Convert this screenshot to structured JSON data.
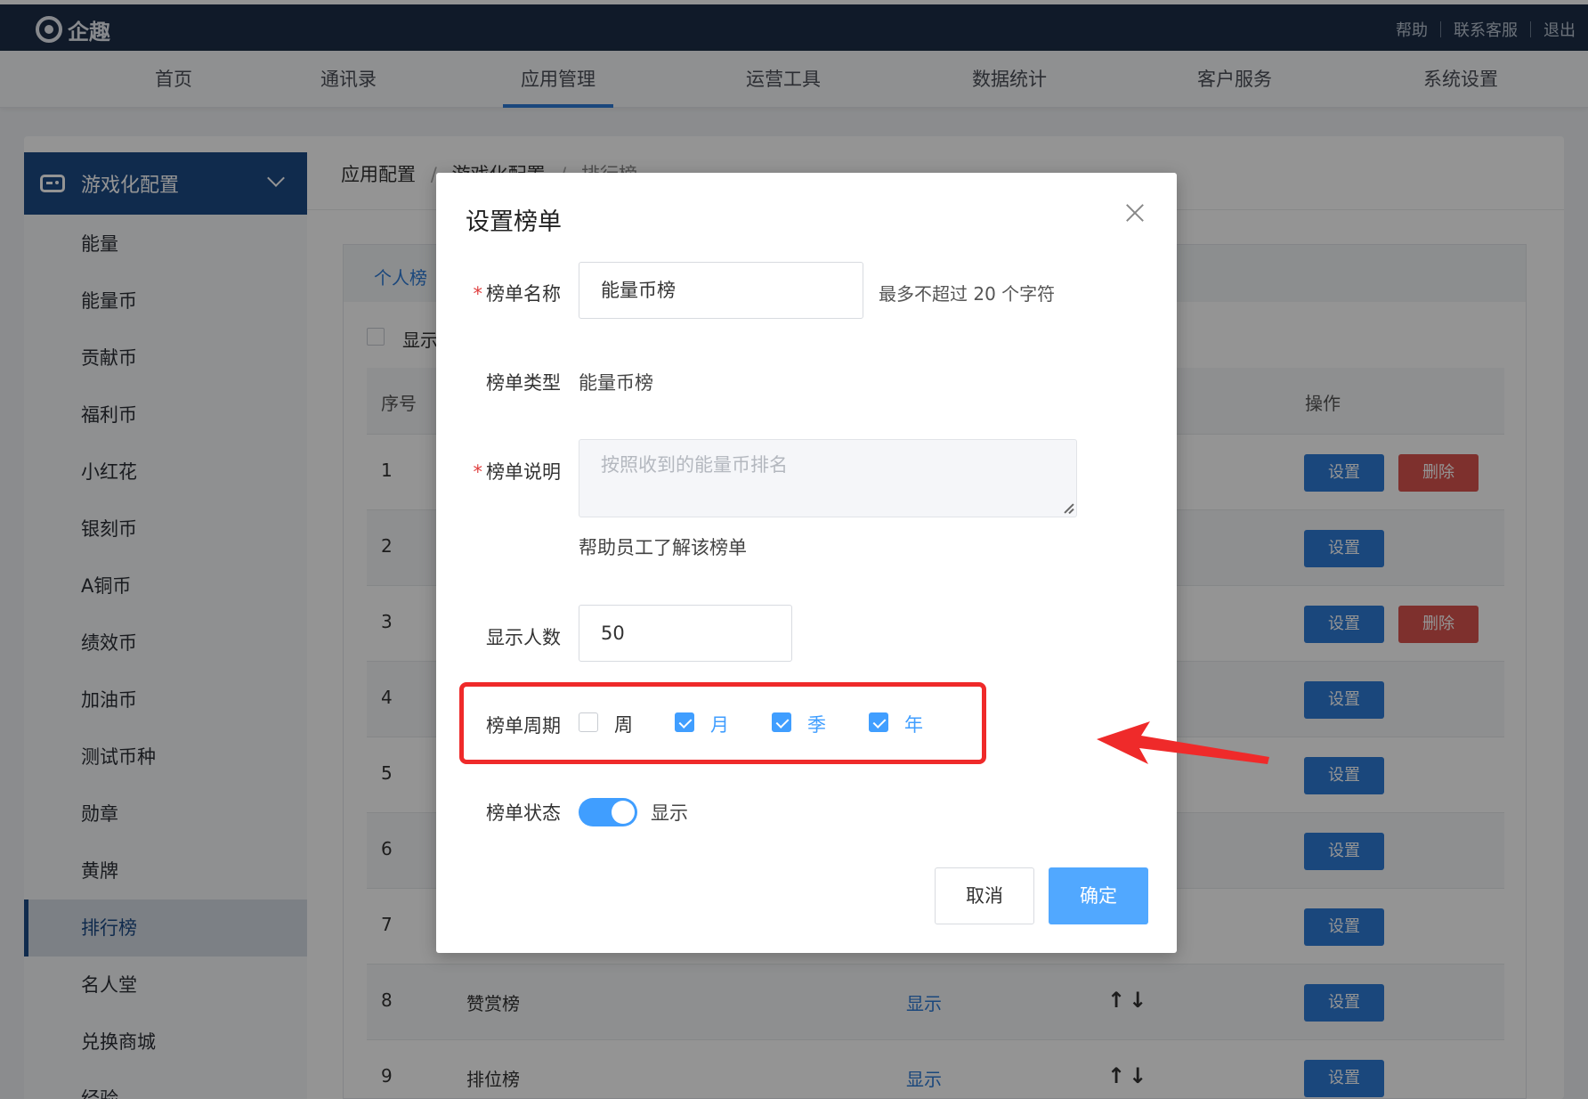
{
  "topbar": {
    "logo": "企趣",
    "links": [
      "帮助",
      "联系客服",
      "退出"
    ]
  },
  "nav": {
    "items": [
      "首页",
      "通讯录",
      "应用管理",
      "运营工具",
      "数据统计",
      "客户服务",
      "系统设置"
    ],
    "active": "应用管理"
  },
  "sidebar": {
    "header": "游戏化配置",
    "items": [
      "能量",
      "能量币",
      "贡献币",
      "福利币",
      "小红花",
      "银刻币",
      "A铜币",
      "绩效币",
      "加油币",
      "测试币种",
      "勋章",
      "黄牌",
      "排行榜",
      "名人堂",
      "兑换商城",
      "经验"
    ],
    "active": "排行榜"
  },
  "breadcrumb": {
    "root": "应用配置",
    "sep1": "/",
    "middle": "游戏化配置",
    "sep2": "/",
    "current": "排行榜"
  },
  "page": {
    "tab": "个人榜",
    "show_label": "显示"
  },
  "table": {
    "headers": {
      "index": "序号",
      "actions": "操作"
    },
    "set_label": "设置",
    "delete_label": "删除",
    "arrows": "↑↓",
    "rows": [
      {
        "index": "1"
      },
      {
        "index": "2"
      },
      {
        "index": "3"
      },
      {
        "index": "4"
      },
      {
        "index": "5"
      },
      {
        "index": "6"
      },
      {
        "index": "7"
      },
      {
        "index": "8",
        "name": "赞赏榜",
        "status": "显示"
      },
      {
        "index": "9",
        "name": "排位榜",
        "status": "显示"
      }
    ]
  },
  "modal": {
    "title": "设置榜单",
    "name_label": "榜单名称",
    "name_value": "能量币榜",
    "name_hint": "最多不超过 20 个字符",
    "type_label": "榜单类型",
    "type_value": "能量币榜",
    "desc_label": "榜单说明",
    "desc_placeholder": "按照收到的能量币排名",
    "desc_help": "帮助员工了解该榜单",
    "count_label": "显示人数",
    "count_value": "50",
    "period_label": "榜单周期",
    "periods": [
      {
        "label": "周",
        "checked": false
      },
      {
        "label": "月",
        "checked": true
      },
      {
        "label": "季",
        "checked": true
      },
      {
        "label": "年",
        "checked": true
      }
    ],
    "status_label": "榜单状态",
    "status_on": true,
    "status_text": "显示",
    "cancel": "取消",
    "confirm": "确定"
  },
  "colors": {
    "topbar": "#1c2e47",
    "primary": "#2d7ad6",
    "checkbox": "#409eff",
    "danger": "#d9534f",
    "annotation": "#ef2a2a"
  }
}
